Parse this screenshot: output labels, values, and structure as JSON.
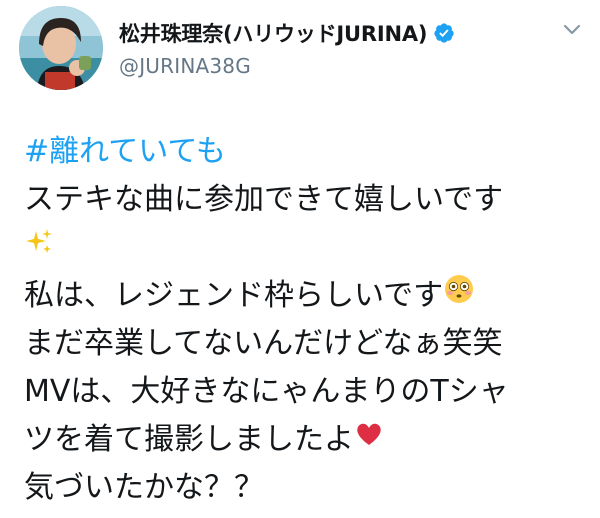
{
  "tweet": {
    "author": {
      "display_name": "松井珠理奈(ハリウッドJURINA)",
      "handle": "@JURINA38G",
      "verified": true
    },
    "menu_icon": "chevron-down-icon",
    "body": {
      "hashtag": "#離れていても",
      "line1": "ステキな曲に参加できて嬉しいです",
      "line2_emoji": "✨",
      "line3": "私は、レジェンド枠らしいです",
      "line3_emoji": "😳",
      "line4": "まだ卒業してないんだけどなぁ笑笑",
      "line5": "MVは、大好きなにゃんまりのTシャ",
      "line6": "ツを着て撮影しましたよ",
      "line6_emoji": "❤️",
      "line7": "気づいたかな？？"
    }
  },
  "colors": {
    "text": "#14171a",
    "secondary": "#657786",
    "accent": "#1da1f2"
  }
}
